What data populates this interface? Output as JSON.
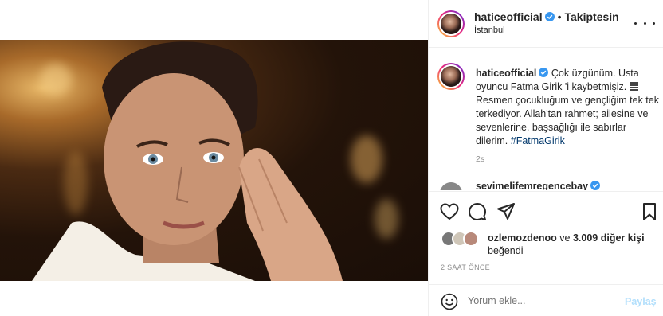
{
  "post": {
    "username": "haticeofficial",
    "separator": "•",
    "follow_status": "Takiptesin",
    "location": "İstanbul"
  },
  "caption": {
    "username": "haticeofficial",
    "text_before": " Çok üzgünüm. Usta oyuncu Fatma Girik 'i kaybetmişiz. ",
    "text_after": "Resmen çocukluğum ve gençliğim tek tek terkediyor. Allah'tan rahmet; ailesine ve sevenlerine, başsağlığı ile sabırlar dilerim. ",
    "hashtag": "#FatmaGirik",
    "time_ago": "2s"
  },
  "next_comment": {
    "username": "sevimelifemregencebay"
  },
  "likes": {
    "liker": "ozlemozdenoo",
    "connector": " ve ",
    "others": "3.009 diğer kişi",
    "verb": "beğendi"
  },
  "timestamp": "2 SAAT ÖNCE",
  "comment_box": {
    "placeholder": "Yorum ekle...",
    "post_label": "Paylaş"
  },
  "icons": {
    "more": "more-options-icon",
    "verified": "verified-badge-icon",
    "like": "heart-icon",
    "comment": "comment-icon",
    "share": "share-icon",
    "save": "bookmark-icon",
    "emoji": "emoji-icon"
  },
  "colors": {
    "verified": "#3897f0",
    "link": "#00376b",
    "post_disabled": "#b2dffc",
    "muted": "#8e8e8e"
  }
}
